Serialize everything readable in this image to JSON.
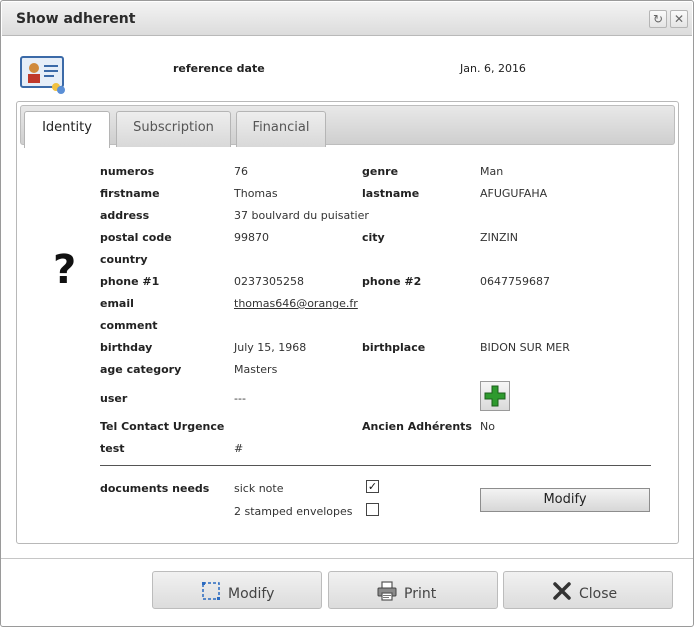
{
  "window": {
    "title": "Show adherent"
  },
  "header": {
    "ref_label": "reference date",
    "ref_value": "Jan. 6, 2016"
  },
  "tabs": [
    {
      "label": "Identity",
      "active": true
    },
    {
      "label": "Subscription",
      "active": false
    },
    {
      "label": "Financial",
      "active": false
    }
  ],
  "identity": {
    "photo_placeholder": "?",
    "numeros_label": "numeros",
    "numeros": "76",
    "genre_label": "genre",
    "genre": "Man",
    "firstname_label": "firstname",
    "firstname": "Thomas",
    "lastname_label": "lastname",
    "lastname": "AFUGUFAHA",
    "address_label": "address",
    "address": "37 boulvard du puisatier",
    "postal_label": "postal code",
    "postal": "99870",
    "city_label": "city",
    "city": "ZINZIN",
    "country_label": "country",
    "country": "",
    "phone1_label": "phone #1",
    "phone1": "0237305258",
    "phone2_label": "phone #2",
    "phone2": "0647759687",
    "email_label": "email",
    "email": "thomas646@orange.fr",
    "comment_label": "comment",
    "comment": "",
    "birthday_label": "birthday",
    "birthday": "July 15, 1968",
    "birthplace_label": "birthplace",
    "birthplace": "BIDON SUR MER",
    "agecat_label": "age category",
    "agecat": "Masters",
    "user_label": "user",
    "user": "---",
    "tel_urgence_label": "Tel Contact Urgence",
    "tel_urgence": "",
    "ancien_label": "Ancien Adhérents",
    "ancien": "No",
    "test_label": "test",
    "test": "#"
  },
  "documents": {
    "label": "documents needs",
    "items": [
      {
        "label": "sick note",
        "checked": true
      },
      {
        "label": "2 stamped envelopes",
        "checked": false
      }
    ],
    "modify_label": "Modify"
  },
  "footer": {
    "modify": "Modify",
    "print": "Print",
    "close": "Close"
  },
  "colors": {
    "add_icon": "#2e9a2e"
  }
}
